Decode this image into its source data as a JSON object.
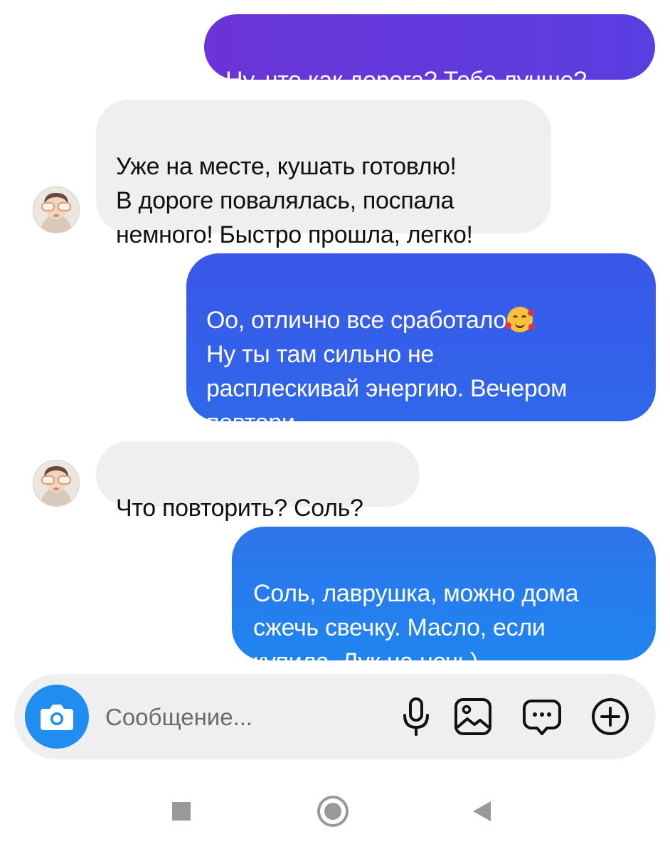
{
  "messages": [
    {
      "direction": "outgoing",
      "text": "Ну, что как дорога? Тебе лучше?"
    },
    {
      "direction": "incoming",
      "text": "Уже на месте, кушать готовлю!\nВ дороге повалялась, поспала\nнемного! Быстро прошла, легко!"
    },
    {
      "direction": "outgoing",
      "text": "Оо, отлично все сработало",
      "emoji": "smiling-face-with-hearts",
      "text_after": "Ну ты там сильно не\nрасплескивай энергию. Вечером\nповтори."
    },
    {
      "direction": "incoming",
      "text": "Что повторить? Соль?"
    },
    {
      "direction": "outgoing",
      "text": "Соль, лаврушка, можно дома\nсжечь свечку. Масло, если\nкупила. Лук на ночь)"
    }
  ],
  "composer": {
    "placeholder": "Сообщение...",
    "icons": [
      "camera-icon",
      "microphone-icon",
      "gallery-icon",
      "sticker-icon",
      "add-icon"
    ]
  },
  "colors": {
    "outgoing_purple": "#6a34d6",
    "outgoing_blue": "#3a57e8",
    "outgoing_light_blue": "#1f85ee",
    "incoming_bg": "#efefef",
    "camera_button": "#1f8ef0"
  },
  "navigation": {
    "buttons": [
      "recents",
      "home",
      "back"
    ]
  }
}
